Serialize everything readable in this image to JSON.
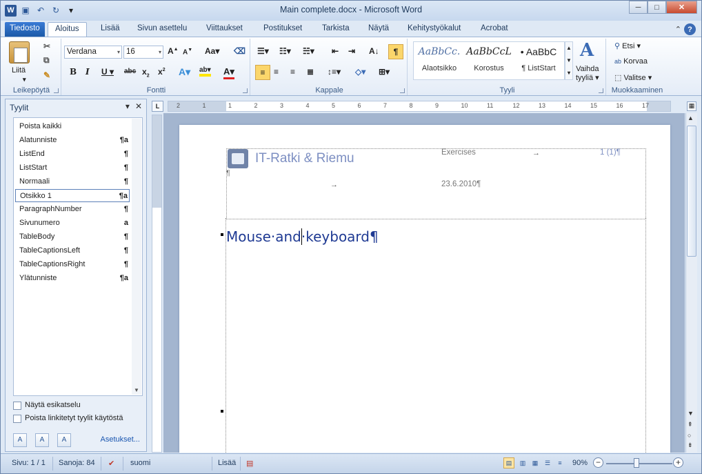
{
  "window": {
    "title": "Main complete.docx - Microsoft Word",
    "app_letter": "W"
  },
  "ribbon_tabs": [
    "Tiedosto",
    "Aloitus",
    "Lisää",
    "Sivun asettelu",
    "Viittaukset",
    "Postitukset",
    "Tarkista",
    "Näytä",
    "Kehitystyökalut",
    "Acrobat"
  ],
  "active_tab": "Aloitus",
  "clipboard": {
    "paste": "Liitä",
    "label": "Leikepöytä"
  },
  "font": {
    "name": "Verdana",
    "size": "16",
    "label": "Fontti"
  },
  "paragraph": {
    "label": "Kappale"
  },
  "styles_gallery": {
    "items": [
      {
        "sample": "AaBbCc.",
        "name": "Alaotsikko"
      },
      {
        "sample": "AaBbCcL",
        "name": "Korostus"
      },
      {
        "sample": "• AaBbC",
        "name": "¶ ListStart"
      }
    ],
    "change": "Vaihda",
    "change2": "tyyliä",
    "label": "Tyyli"
  },
  "editing": {
    "find": "Etsi",
    "replace": "Korvaa",
    "select": "Valitse",
    "label": "Muokkaaminen"
  },
  "styles_pane": {
    "title": "Tyylit",
    "items": [
      {
        "name": "Poista kaikki",
        "mark": ""
      },
      {
        "name": "Alatunniste",
        "mark": "¶a"
      },
      {
        "name": "ListEnd",
        "mark": "¶"
      },
      {
        "name": "ListStart",
        "mark": "¶"
      },
      {
        "name": "Normaali",
        "mark": "¶"
      },
      {
        "name": "Otsikko 1",
        "mark": "¶a"
      },
      {
        "name": "ParagraphNumber",
        "mark": "¶"
      },
      {
        "name": "Sivunumero",
        "mark": "a"
      },
      {
        "name": "TableBody",
        "mark": "¶"
      },
      {
        "name": "TableCaptionsLeft",
        "mark": "¶"
      },
      {
        "name": "TableCaptionsRight",
        "mark": "¶"
      },
      {
        "name": "Ylätunniste",
        "mark": "¶a"
      }
    ],
    "selected": "Otsikko 1",
    "show_preview": "Näytä esikatselu",
    "disable_linked": "Poista linkitetyt tyylit käytöstä",
    "options": "Asetukset..."
  },
  "document": {
    "brand": "IT-Ratki & Riemu",
    "header_title": "Exercises",
    "page_ref": "1 (1)¶",
    "date": "23.6.2010¶",
    "pilcrow": "¶",
    "arrow": "→",
    "heading": "Mouse·and·keyboard¶"
  },
  "ruler_numbers": [
    "2",
    "1",
    "1",
    "2",
    "3",
    "4",
    "5",
    "6",
    "7",
    "8",
    "9",
    "10",
    "11",
    "12",
    "13",
    "14",
    "15",
    "16",
    "17"
  ],
  "status": {
    "page": "Sivu: 1 / 1",
    "words": "Sanoja: 84",
    "lang": "suomi",
    "insert": "Lisää",
    "zoom": "90%"
  }
}
